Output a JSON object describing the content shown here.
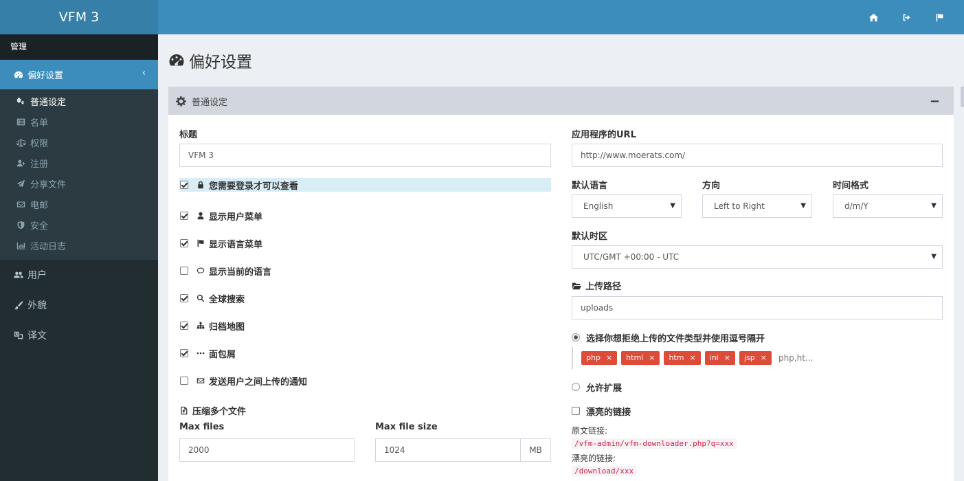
{
  "app": {
    "logo": "VFM 3"
  },
  "topnav": {
    "icons": [
      "home-icon",
      "sign-out-icon",
      "flag-icon"
    ]
  },
  "sidebar": {
    "header": "管理",
    "active": {
      "label": "偏好设置",
      "icon": "dashboard-icon"
    },
    "sub_items": [
      {
        "label": "普通设定",
        "icon": "cogs-icon",
        "current": true
      },
      {
        "label": "名单",
        "icon": "list-icon"
      },
      {
        "label": "权限",
        "icon": "balance-scale-icon"
      },
      {
        "label": "注册",
        "icon": "user-plus-icon"
      },
      {
        "label": "分享文件",
        "icon": "paper-plane-icon"
      },
      {
        "label": "电邮",
        "icon": "envelope-icon"
      },
      {
        "label": "安全",
        "icon": "shield-icon"
      },
      {
        "label": "活动日志",
        "icon": "bar-chart-icon"
      }
    ],
    "items": [
      {
        "label": "用户",
        "icon": "users-icon"
      },
      {
        "label": "外貌",
        "icon": "paint-brush-icon"
      },
      {
        "label": "译文",
        "icon": "language-icon"
      }
    ]
  },
  "page": {
    "title": "偏好设置"
  },
  "panel": {
    "title": "普通设定",
    "left": {
      "title_label": "标题",
      "title_value": "VFM 3",
      "checks": [
        {
          "label": "您需要登录才可以查看",
          "checked": true,
          "icon": "lock-icon",
          "highlight": true
        },
        {
          "label": "显示用户菜单",
          "checked": true,
          "icon": "user-icon"
        },
        {
          "label": "显示语言菜单",
          "checked": true,
          "icon": "flag-icon"
        },
        {
          "label": "显示当前的语言",
          "checked": false,
          "icon": "comment-icon"
        },
        {
          "label": "全球搜索",
          "checked": true,
          "icon": "search-icon"
        },
        {
          "label": "归档地图",
          "checked": true,
          "icon": "sitemap-icon"
        },
        {
          "label": "面包屑",
          "checked": true,
          "icon": "ellipsis-icon"
        },
        {
          "label": "发送用户之间上传的通知",
          "checked": false,
          "icon": "envelope-icon"
        }
      ],
      "zip_title": "压缩多个文件",
      "max_files_label": "Max files",
      "max_files_value": "2000",
      "max_size_label": "Max file size",
      "max_size_value": "1024",
      "max_size_unit": "MB"
    },
    "right": {
      "app_url_label": "应用程序的URL",
      "app_url_value": "http://www.moerats.com/",
      "lang_label": "默认语言",
      "lang_value": "English",
      "dir_label": "方向",
      "dir_value": "Left to Right",
      "time_label": "时间格式",
      "time_value": "d/m/Y",
      "tz_label": "默认时区",
      "tz_value": "UTC/GMT +00:00 - UTC",
      "upload_label": "上传路径",
      "upload_value": "uploads",
      "reject_label": "选择你想拒绝上传的文件类型并使用逗号隔开",
      "reject_selected": true,
      "tags": [
        "php",
        "html",
        "htm",
        "ini",
        "jsp"
      ],
      "tag_input": "php,ht...",
      "allow_label": "允许扩展",
      "allow_selected": false,
      "pretty_label": "漂亮的链接",
      "pretty_checked": false,
      "orig_link_label": "原文链接:",
      "orig_link_value": "/vfm-admin/vfm-downloader.php?q=xxx",
      "pretty_link_label": "漂亮的链接:",
      "pretty_link_value": "/download/xxx"
    }
  }
}
